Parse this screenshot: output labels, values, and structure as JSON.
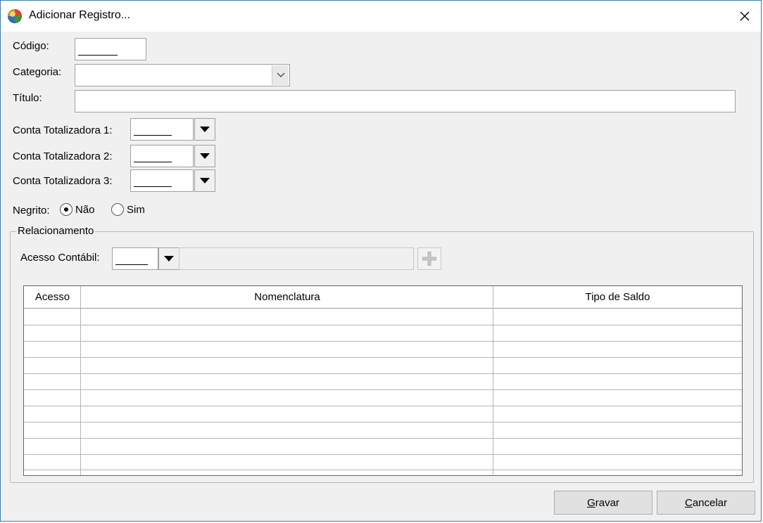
{
  "window": {
    "title": "Adicionar Registro...",
    "close_glyph": "×"
  },
  "form": {
    "codigo_label": "Código:",
    "categoria_label": "Categoria",
    "categoria_colon": ":",
    "titulo_label": "Título:",
    "conta1_label": "Conta Totalizadora 1:",
    "conta2_label": "Conta Totalizadora 2:",
    "conta3_label": "Conta Totalizadora 3:",
    "negrito_label": "Negrito:",
    "negrito_options": [
      {
        "label": "Não",
        "checked": true
      },
      {
        "label": "Sim",
        "checked": false
      }
    ]
  },
  "relacionamento": {
    "group_label": "Relacionamento",
    "acesso_contabil_label": "Acesso Contábil:"
  },
  "grid": {
    "columns": [
      "Acesso",
      "Nomenclatura",
      "Tipo de Saldo"
    ]
  },
  "buttons": {
    "gravar_prefix": "G",
    "gravar_rest": "ravar",
    "cancelar_prefix": "C",
    "cancelar_rest": "ancelar"
  },
  "colors": {
    "window_border": "#3c7fb1",
    "dialog_bg": "#f0f0f0"
  }
}
